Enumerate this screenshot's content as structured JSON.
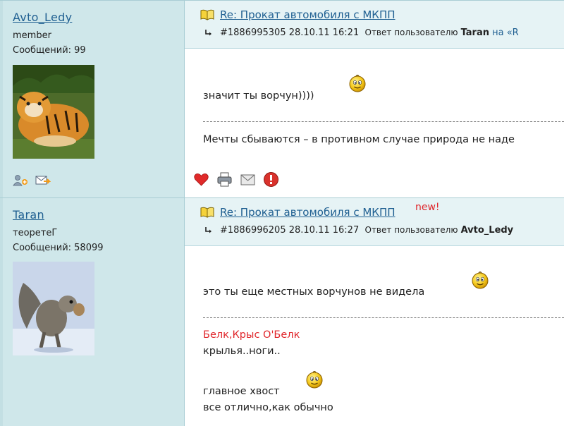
{
  "posts": [
    {
      "author": {
        "name": "Avto_Ledy",
        "rank": "member",
        "messages": "Сообщений: 99",
        "avatar": "tiger-avatar"
      },
      "title": "Re: Прокат автомобиля с МКПП",
      "new_badge": "",
      "meta": {
        "id_time": "#1886995305 28.10.11 16:21",
        "reply_label": "Ответ пользователю",
        "reply_user": "Taran",
        "tail": "на «R"
      },
      "body": {
        "line1": "значит ты ворчун))))"
      },
      "signature": {
        "line1": "Мечты сбываются – в противном случае природа не наде"
      }
    },
    {
      "author": {
        "name": "Taran",
        "rank": "теоретеГ",
        "messages": "Сообщений: 58099",
        "avatar": "squirrel-avatar"
      },
      "title": "Re: Прокат автомобиля с МКПП",
      "new_badge": "new!",
      "meta": {
        "id_time": "#1886996205 28.10.11 16:27",
        "reply_label": "Ответ пользователю",
        "reply_user": "Avto_Ledy",
        "tail": ""
      },
      "body": {
        "line1": "это ты еще местных ворчунов не видела"
      },
      "signature": {
        "line1": "Белк,Крыс О'Белк",
        "line2": "крылья..ноги..",
        "line3": "главное хвост",
        "line4": "все отлично,как обычно"
      }
    }
  ],
  "icons": {
    "add_friend": "add-friend-icon",
    "send_message": "send-message-icon",
    "like": "heart-icon",
    "print": "printer-icon",
    "email": "envelope-icon",
    "report": "warning-icon"
  },
  "colors": {
    "author_bg": "#cfe7ea",
    "header_bg": "#e6f3f5",
    "link": "#1f5f91",
    "accent_red": "#e0262b"
  }
}
